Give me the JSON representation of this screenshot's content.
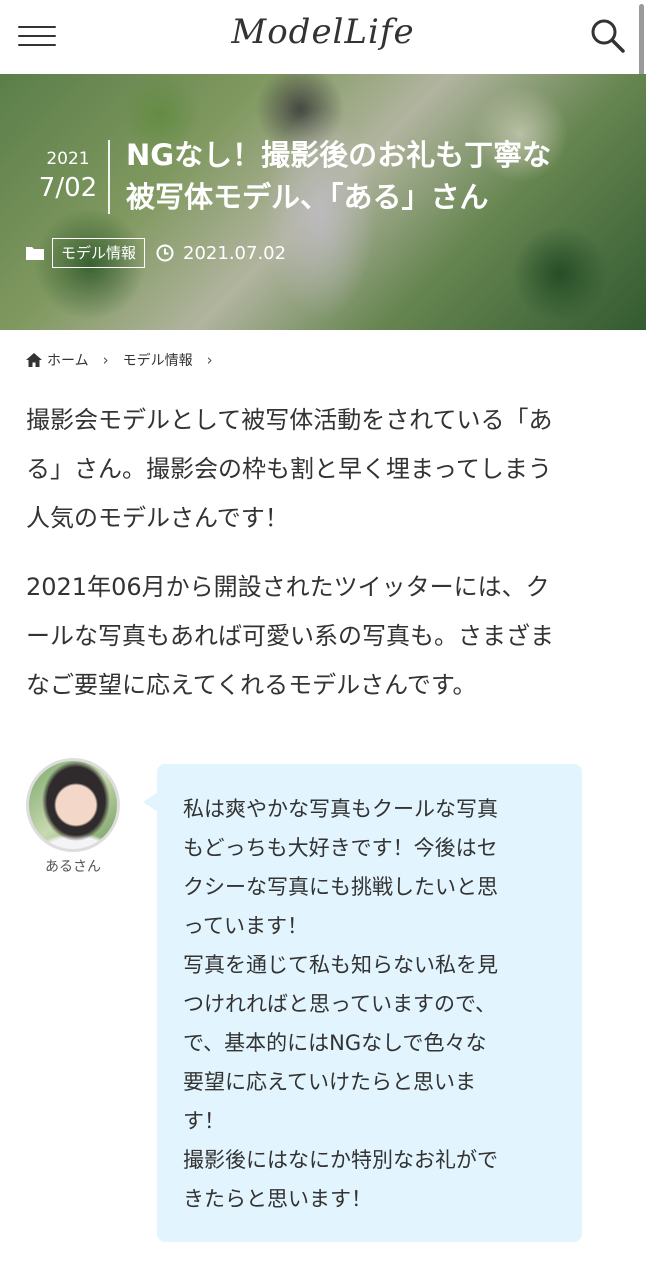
{
  "header": {
    "logo": "ModelLife"
  },
  "hero": {
    "year": "2021",
    "month_day": "7/02",
    "title_line1": "NGなし！撮影後のお礼も丁寧な",
    "title_line2": "被写体モデル、「ある」さん",
    "category": "モデル情報",
    "date": "2021.07.02"
  },
  "breadcrumb": {
    "home": "ホーム",
    "category": "モデル情報"
  },
  "article": {
    "para1_lines": [
      "撮影会モデルとして被写体活動をされている「あ",
      "る」さん。撮影会の枠も割と早く埋まってしまう",
      "人気のモデルさんです！"
    ],
    "para2_lines": [
      "2021年06月から開設されたツイッターには、ク",
      "ールな写真もあれば可愛い系の写真も。さまざま",
      "なご要望に応えてくれるモデルさんです。"
    ]
  },
  "speech": {
    "speaker_name": "あるさん",
    "text": "私は爽やかな写真もクールな写真\nもどっちも大好きです！今後はセ\nクシーな写真にも挑戦したいと思\nっています！\n写真を通じて私も知らない私を見\nつけれればと思っていますので、\nで、基本的にはNGなしで色々な\n要望に応えていけたらと思いま\nす！\n撮影後にはなにか特別なお礼がで\nきたらと思います！"
  },
  "colors": {
    "bubble": "#e2f4fd",
    "text": "#333333"
  }
}
